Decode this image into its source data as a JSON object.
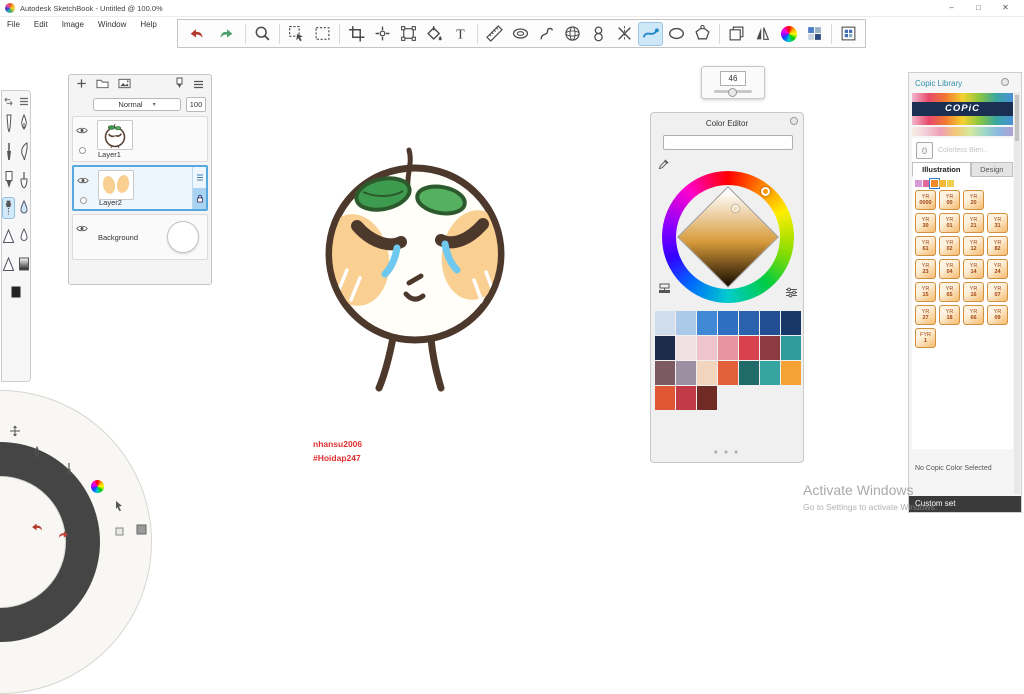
{
  "window": {
    "title": "Autodesk SketchBook - Untitled @ 100.0%",
    "controls": {
      "minimize": "–",
      "maximize": "□",
      "close": "✕"
    }
  },
  "menu": {
    "items": [
      "File",
      "Edit",
      "Image",
      "Window",
      "Help"
    ]
  },
  "toolbar": {
    "icons": [
      "undo",
      "redo",
      "zoom",
      "selection",
      "marquee",
      "crop",
      "transform",
      "distort",
      "fill",
      "text",
      "ruler",
      "ellipse-guide",
      "french-curve",
      "perspective",
      "symmetry-vertical",
      "symmetry-horizontal",
      "steady-stroke",
      "ellipse",
      "polyline",
      "copy-layer",
      "brushes",
      "color-wheel",
      "color-palette",
      "marketplace"
    ],
    "active": "steady-stroke",
    "accent_blue": "#1e87c8",
    "undo_red": "#b23c2b",
    "redo_green": "#4f9e6e"
  },
  "tool_palette": {
    "icons": [
      "transform",
      "menu",
      "pencil",
      "ballpoint-pen",
      "paintbrush",
      "quill",
      "marker",
      "smudge",
      "airbrush",
      "water-droplet",
      "triangle",
      "droplet",
      "triangle-alt",
      "gradient",
      "solid-square"
    ],
    "selected": "airbrush"
  },
  "puck": {
    "icons": [
      "transform",
      "pen",
      "brush",
      "color-wheel",
      "cursor",
      "swatch",
      "undo",
      "redo",
      "swatch-small"
    ]
  },
  "brush_popup": {
    "size": "46"
  },
  "layers_panel": {
    "blend_mode": "Normal",
    "opacity": "100",
    "layers": [
      {
        "name": "Layer1",
        "selected": false
      },
      {
        "name": "Layer2",
        "selected": true
      },
      {
        "name": "Background",
        "selected": false
      }
    ]
  },
  "color_editor": {
    "title": "Color Editor",
    "swatch_rows": [
      [
        "#cfdded",
        "#abc9e9",
        "#4189d6",
        "#2f6fc2",
        "#2a62ae",
        "#224f93",
        "#18386a"
      ],
      [
        "#1b2b49",
        "#f1e1e3",
        "#efc5cb",
        "#e795a0",
        "#d8414d",
        "#8d3b42",
        "#2f9b9b"
      ],
      [
        "#7c5a63",
        "#9c8fa1",
        "#f3d5bd",
        "#e4603c",
        "#206a6a",
        "#36a4a0",
        "#f3a233"
      ],
      [
        "#e05634",
        "#c23a45",
        "#6f2b24"
      ]
    ]
  },
  "copic": {
    "title": "Copic Library",
    "logo": "COPiC",
    "blender_value": "0",
    "blender_label": "Colorless Blen..",
    "tabs": [
      "Illustration",
      "Design"
    ],
    "active_tab": "Illustration",
    "mini_palette": [
      "#d79ad4",
      "#e2679f",
      "#ef8b2a",
      "#f3b73a",
      "#eecf4e"
    ],
    "mini_selected": 2,
    "chip_rows": [
      3,
      4,
      4,
      4,
      4,
      4,
      1
    ],
    "chips": [
      [
        "YR",
        "0000"
      ],
      [
        "YR",
        "00"
      ],
      [
        "YR",
        "20"
      ],
      [
        "YR",
        "30"
      ],
      [
        "YR",
        "01"
      ],
      [
        "YR",
        "21"
      ],
      [
        "YR",
        "31"
      ],
      [
        "YR",
        "61"
      ],
      [
        "YR",
        "02"
      ],
      [
        "YR",
        "12"
      ],
      [
        "YR",
        "82"
      ],
      [
        "YR",
        "23"
      ],
      [
        "YR",
        "04"
      ],
      [
        "YR",
        "14"
      ],
      [
        "YR",
        "24"
      ],
      [
        "YR",
        "15"
      ],
      [
        "YR",
        "65"
      ],
      [
        "YR",
        "16"
      ],
      [
        "YR",
        "07"
      ],
      [
        "YR",
        "27"
      ],
      [
        "YR",
        "18"
      ],
      [
        "YR",
        "66"
      ],
      [
        "YR",
        "09"
      ],
      [
        "FYR",
        "1"
      ]
    ],
    "footer": "No Copic Color Selected",
    "custom_set": "Custom set"
  },
  "canvas": {
    "signature_line1": "nhansu2006",
    "signature_line2": "#Hoidap247",
    "signature_color": "#e03030"
  },
  "watermark": {
    "line1": "Activate Windows",
    "line2": "Go to Settings to activate Windows."
  }
}
